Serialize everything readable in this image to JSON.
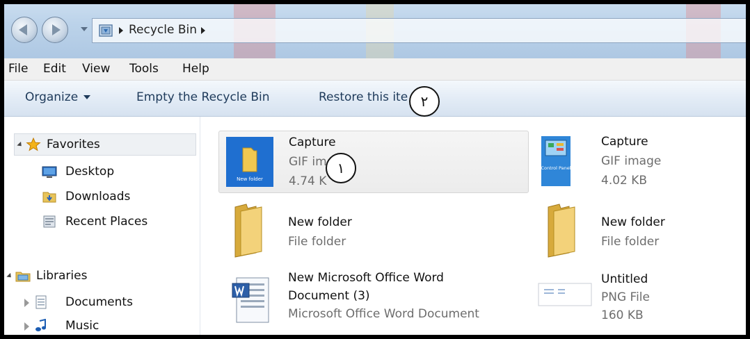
{
  "address": {
    "crumbs": [
      "Recycle Bin"
    ]
  },
  "menu": [
    "File",
    "Edit",
    "View",
    "Tools",
    "Help"
  ],
  "commands": {
    "organize": "Organize",
    "empty": "Empty the Recycle Bin",
    "restore": "Restore this ite"
  },
  "nav": {
    "favorites": "Favorites",
    "desktop": "Desktop",
    "downloads": "Downloads",
    "recent": "Recent Places",
    "libraries": "Libraries",
    "documents": "Documents",
    "music": "Music"
  },
  "items": [
    {
      "name": "Capture",
      "type": "GIF im",
      "size": "4.74 K",
      "icon": "folder-gif-thumbnail-icon"
    },
    {
      "name": "Capture",
      "type": "GIF image",
      "size": "4.02 KB",
      "icon": "control-panel-gif-thumbnail-icon"
    },
    {
      "name": "New folder",
      "type": "File folder",
      "icon": "folder-icon"
    },
    {
      "name": "New folder",
      "type": "File folder",
      "icon": "folder-icon"
    },
    {
      "name_line1": "New Microsoft Office Word",
      "name_line2": "Document (3)",
      "type": "Microsoft Office Word Document",
      "icon": "word-document-icon"
    },
    {
      "name": "Untitled",
      "type": "PNG File",
      "size": "160 KB",
      "icon": "png-thumbnail-icon"
    }
  ],
  "callouts": {
    "one": "١",
    "two": "٢"
  },
  "thumb_labels": {
    "newfolder": "New folder",
    "control_panel": "Control Panel"
  },
  "colors": {
    "accent": "#1e3a5a",
    "selection": "#eef1f4",
    "folder": "#e8c45a"
  }
}
